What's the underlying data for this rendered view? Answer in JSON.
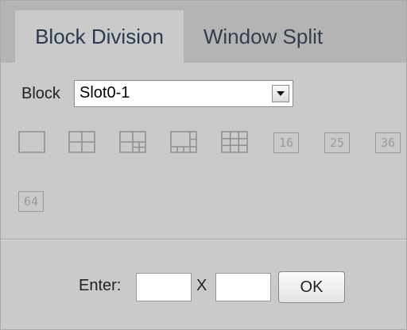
{
  "tabs": [
    {
      "label": "Block Division",
      "active": true
    },
    {
      "label": "Window Split",
      "active": false
    }
  ],
  "block": {
    "label": "Block",
    "selected": "Slot0-1"
  },
  "layouts": {
    "icons": [
      "single-view-icon",
      "quad-view-icon",
      "six-view-icon",
      "eight-view-icon",
      "nine-view-icon"
    ],
    "numbered": [
      "16",
      "25",
      "36",
      "64"
    ]
  },
  "custom": {
    "enter_label": "Enter:",
    "x_label": "X",
    "rows_value": "",
    "cols_value": "",
    "ok_label": "OK"
  },
  "colors": {
    "background": "#cacaca",
    "tabbar": "#b4b4b4",
    "icon_stroke": "#8e8e8e"
  }
}
